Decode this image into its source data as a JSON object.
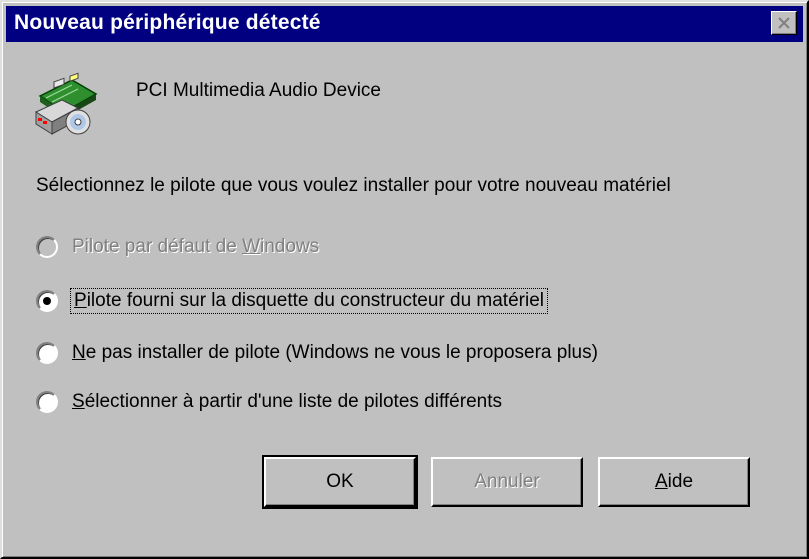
{
  "window": {
    "title": "Nouveau périphérique détecté",
    "titlebar_color": "#000080",
    "close_icon": "close-icon"
  },
  "device": {
    "icon": "sound-card-icon",
    "name": "PCI Multimedia Audio Device"
  },
  "prompt": "Sélectionnez le pilote que vous voulez installer pour votre nouveau matériel",
  "options": [
    {
      "before": "Pilote par défaut de ",
      "accel": "W",
      "after": "indows",
      "enabled": false,
      "selected": false
    },
    {
      "before": "",
      "accel": "P",
      "after": "ilote fourni sur la disquette du constructeur du matériel",
      "enabled": true,
      "selected": true
    },
    {
      "before": "",
      "accel": "N",
      "after": "e pas installer de pilote (Windows ne vous le proposera plus)",
      "enabled": true,
      "selected": false
    },
    {
      "before": "",
      "accel": "S",
      "after": "électionner à partir d'une liste de pilotes différents",
      "enabled": true,
      "selected": false
    }
  ],
  "buttons": {
    "ok": "OK",
    "cancel": "Annuler",
    "help_accel": "A",
    "help_rest": "ide"
  }
}
